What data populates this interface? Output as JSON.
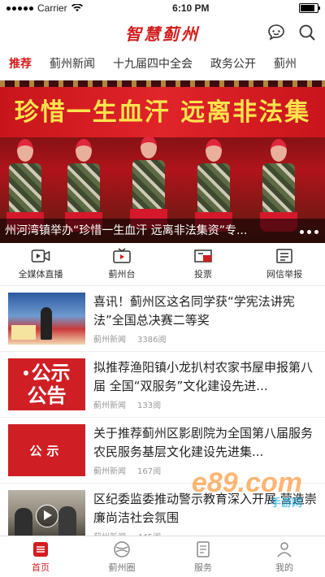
{
  "status_bar": {
    "carrier": "Carrier",
    "time": "6:10 PM",
    "battery_level": 0.95
  },
  "header": {
    "logo_text": "智慧蓟州"
  },
  "tabs": [
    {
      "label": "推荐",
      "active": true
    },
    {
      "label": "蓟州新闻"
    },
    {
      "label": "十九届四中全会"
    },
    {
      "label": "政务公开"
    },
    {
      "label": "蓟州"
    }
  ],
  "banner": {
    "sign_text": "珍惜一生血汗 远离非法集",
    "caption": "州河湾镇举办“珍惜一生血汗 远离非法集资”专...",
    "pager_count": 3
  },
  "quick_links": [
    {
      "label": "全媒体直播",
      "icon": "video-camera-icon"
    },
    {
      "label": "蓟州台",
      "icon": "tv-icon"
    },
    {
      "label": "投票",
      "icon": "vote-icon"
    },
    {
      "label": "网信举报",
      "icon": "report-icon"
    }
  ],
  "news": [
    {
      "title": "喜讯！蓟州区这名同学获“学宪法讲宪法”全国总决赛二等奖",
      "source": "蓟州新闻",
      "reads": "3386阅",
      "thumb": "photo"
    },
    {
      "title": "拟推荐渔阳镇小龙扒村农家书屋申报第八届  全国“双服务”文化建设先进...",
      "source": "蓟州新闻",
      "reads": "133阅",
      "thumb": "公示公告"
    },
    {
      "title": "关于推荐蓟州区影剧院为全国第八届服务农民服务基层文化建设先进集...",
      "source": "蓟州新闻",
      "reads": "167阅",
      "thumb": "公示"
    },
    {
      "title": "区纪委监委推动警示教育深入开展 营造崇廉尚洁社会氛围",
      "source": "蓟州新闻",
      "reads": "445阅",
      "thumb": "video"
    }
  ],
  "watermark": {
    "text": "e89.com",
    "sub": "手游网"
  },
  "bottom_nav": [
    {
      "label": "首页",
      "icon": "home-icon",
      "active": true
    },
    {
      "label": "蓟州圈",
      "icon": "circle-icon"
    },
    {
      "label": "服务",
      "icon": "service-icon"
    },
    {
      "label": "我的",
      "icon": "profile-icon"
    }
  ],
  "colors": {
    "accent": "#d21e1e"
  }
}
